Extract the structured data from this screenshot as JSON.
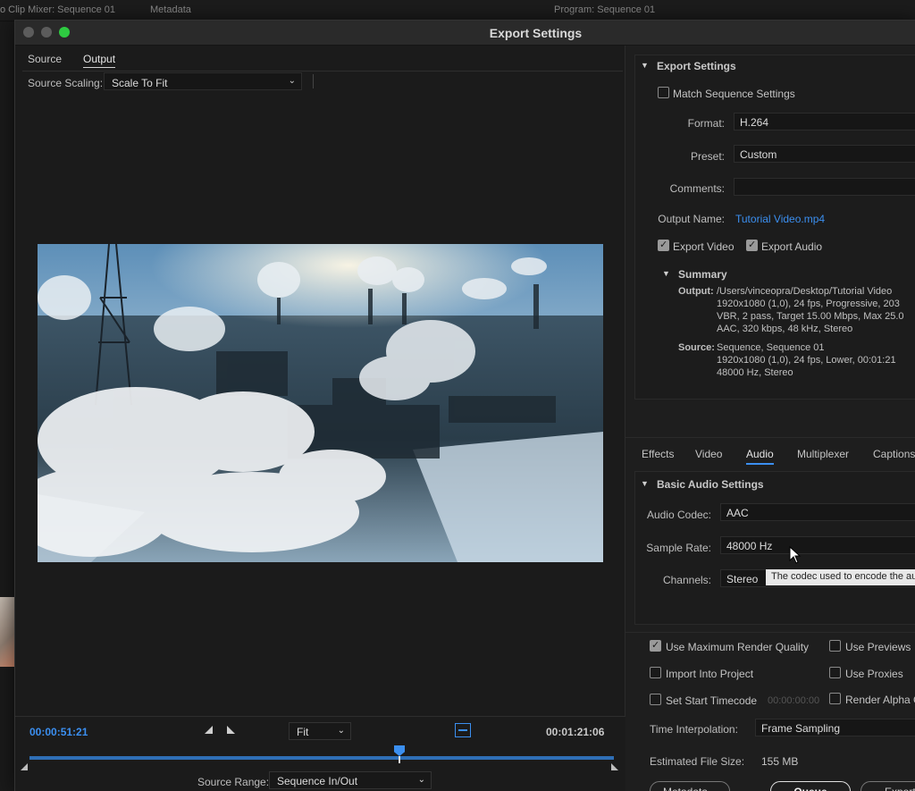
{
  "background": {
    "left_tab": "o Clip Mixer: Sequence 01",
    "metadata_tab": "Metadata",
    "program_tab": "Program: Sequence 01"
  },
  "dialog": {
    "title": "Export Settings",
    "tabs": [
      "Source",
      "Output"
    ],
    "source_scaling_label": "Source Scaling:",
    "source_scaling_value": "Scale To Fit",
    "time_in": "00:00:51:21",
    "time_out": "00:01:21:06",
    "zoom_value": "Fit",
    "source_range_label": "Source Range:",
    "source_range_value": "Sequence In/Out",
    "playhead_fraction": 0.62
  },
  "export_settings": {
    "header": "Export Settings",
    "match_sequence": "Match Sequence Settings",
    "format_label": "Format:",
    "format_value": "H.264",
    "preset_label": "Preset:",
    "preset_value": "Custom",
    "comments_label": "Comments:",
    "comments_value": "",
    "output_name_label": "Output Name:",
    "output_name_value": "Tutorial Video.mp4",
    "export_video": "Export Video",
    "export_audio": "Export Audio",
    "summary_header": "Summary",
    "output_label": "Output:",
    "output_lines": [
      "/Users/vinceopra/Desktop/Tutorial Video",
      "1920x1080 (1,0), 24 fps, Progressive, 203",
      "VBR, 2 pass, Target 15.00 Mbps, Max 25.0",
      "AAC, 320 kbps, 48 kHz, Stereo"
    ],
    "source_label": "Source:",
    "source_lines": [
      "Sequence, Sequence 01",
      "1920x1080 (1,0), 24 fps, Lower, 00:01:21",
      "48000 Hz, Stereo"
    ]
  },
  "tabs": [
    "Effects",
    "Video",
    "Audio",
    "Multiplexer",
    "Captions"
  ],
  "audio": {
    "header": "Basic Audio Settings",
    "codec_label": "Audio Codec:",
    "codec_value": "AAC",
    "tooltip": "The codec used to encode the au",
    "sample_rate_label": "Sample Rate:",
    "sample_rate_value": "48000 Hz",
    "channels_label": "Channels:",
    "channels_value": "Stereo"
  },
  "options": {
    "max_render_quality": "Use Maximum Render Quality",
    "use_previews": "Use Previews",
    "import_into_project": "Import Into Project",
    "use_proxies": "Use Proxies",
    "set_start_timecode": "Set Start Timecode",
    "start_timecode_value": "00:00:00:00",
    "render_alpha": "Render Alpha C",
    "time_interpolation_label": "Time Interpolation:",
    "time_interpolation_value": "Frame Sampling",
    "file_size_label": "Estimated File Size:",
    "file_size_value": "155 MB"
  },
  "buttons": {
    "metadata": "Metadata...",
    "queue": "Queue",
    "export": "Export"
  },
  "colors": {
    "accent": "#3b8ff0",
    "traffic_green": "#2ecb41"
  }
}
